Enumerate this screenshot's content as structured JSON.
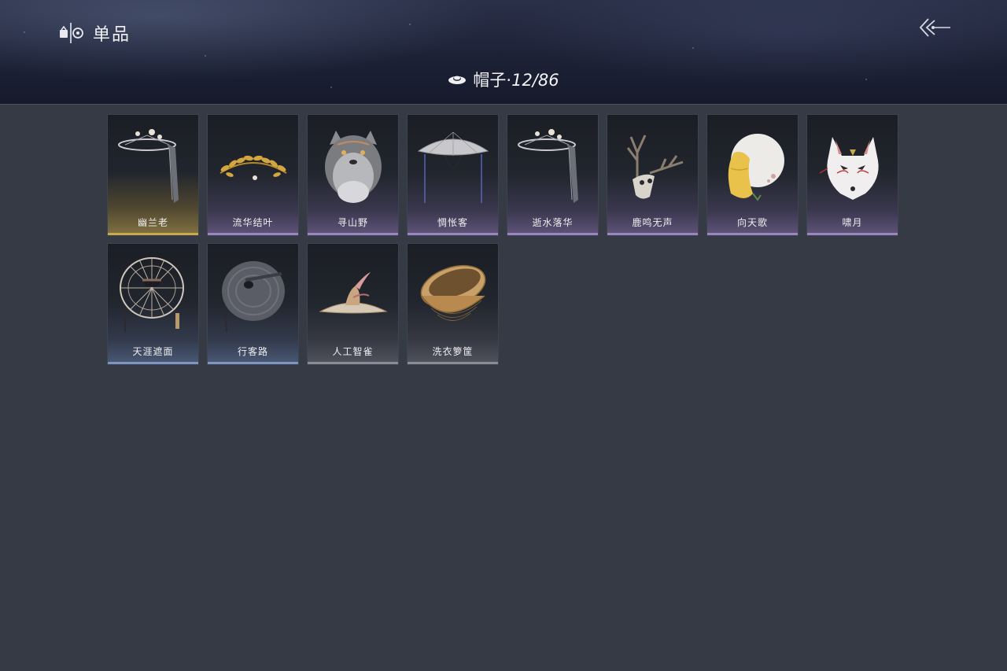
{
  "header": {
    "title": "单品",
    "back_icon": "back-arrow-icon",
    "brand_icon": "wardrobe-icon"
  },
  "category": {
    "icon": "hat-icon",
    "name": "帽子·",
    "count": "12/86"
  },
  "items": [
    {
      "name": "幽兰老",
      "rarity": "gold",
      "art": "veiled-hat"
    },
    {
      "name": "流华结叶",
      "rarity": "purple",
      "art": "golden-laurel"
    },
    {
      "name": "寻山野",
      "rarity": "purple",
      "art": "wolf-headdress"
    },
    {
      "name": "惆怅客",
      "rarity": "purple",
      "art": "wide-brim-hat"
    },
    {
      "name": "逝水落华",
      "rarity": "purple",
      "art": "veiled-hat"
    },
    {
      "name": "鹿鸣无声",
      "rarity": "purple",
      "art": "deer-skull"
    },
    {
      "name": "向天歌",
      "rarity": "purple",
      "art": "goose-mask"
    },
    {
      "name": "啸月",
      "rarity": "purple",
      "art": "fox-mask"
    },
    {
      "name": "天涯遮面",
      "rarity": "blue",
      "art": "bamboo-veil-hat"
    },
    {
      "name": "行客路",
      "rarity": "blue",
      "art": "woven-straw-hat"
    },
    {
      "name": "人工智雀",
      "rarity": "gray",
      "art": "bird-hat"
    },
    {
      "name": "洗衣箩筐",
      "rarity": "gray",
      "art": "basket"
    }
  ],
  "colors": {
    "background": "#353a44",
    "rarity_gold": "#c9a94a",
    "rarity_purple": "#9c86c2",
    "rarity_blue": "#7d95c0",
    "rarity_gray": "#8b8d96"
  }
}
